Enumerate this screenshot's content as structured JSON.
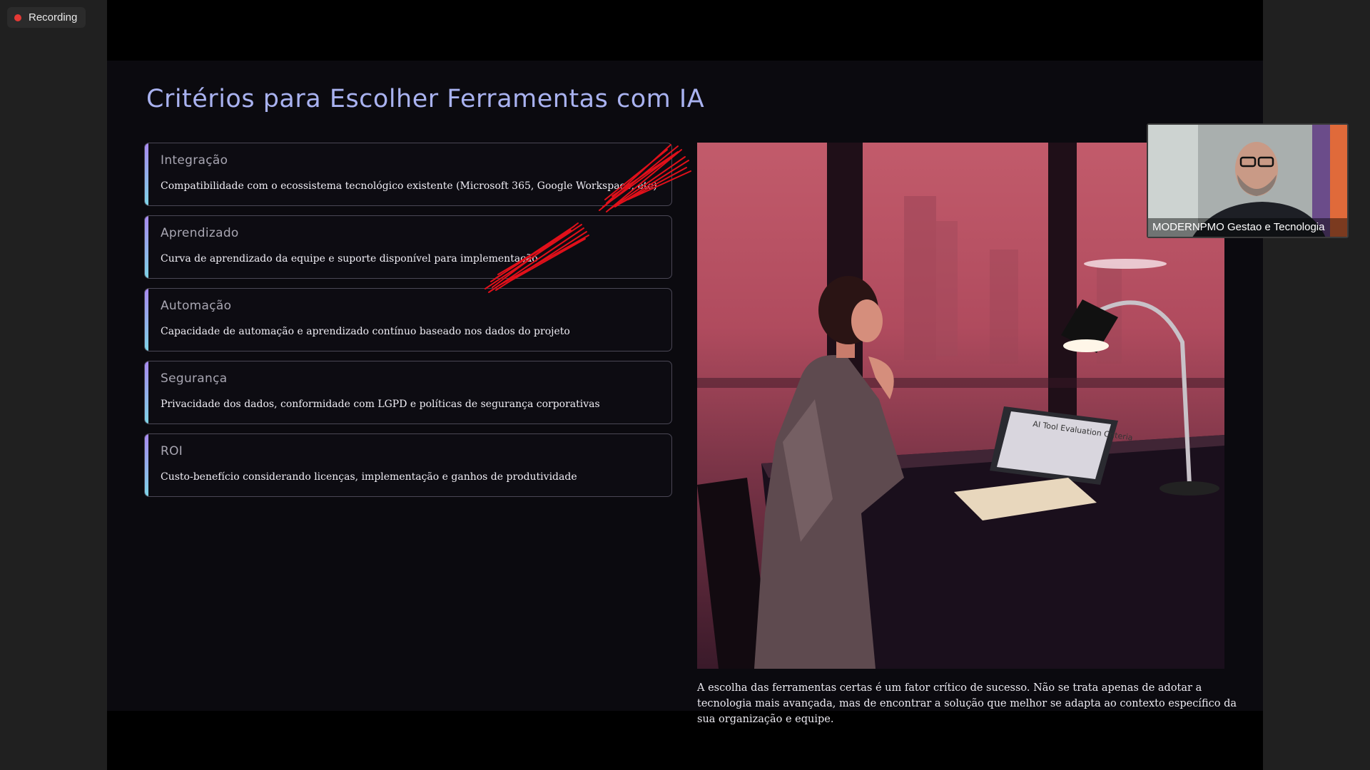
{
  "recording": {
    "label": "Recording",
    "dot_color": "#e53935"
  },
  "slide": {
    "title": "Critérios para Escolher Ferramentas com IA",
    "cards": [
      {
        "title": "Integração",
        "description": "Compatibilidade com o ecossistema tecnológico existente (Microsoft 365, Google Workspace, etc)"
      },
      {
        "title": "Aprendizado",
        "description": "Curva de aprendizado da equipe e suporte disponível para implementação"
      },
      {
        "title": "Automação",
        "description": "Capacidade de automação e aprendizado contínuo baseado nos dados do projeto"
      },
      {
        "title": "Segurança",
        "description": "Privacidade dos dados, conformidade com LGPD e políticas de segurança corporativas"
      },
      {
        "title": "ROI",
        "description": "Custo-benefício considerando licenças, implementação e ganhos de produtividade"
      }
    ],
    "image": {
      "screen_text": "AI Tool Evaluation Criteria"
    },
    "caption": "A escolha das ferramentas certas é um fator crítico de sucesso. Não se trata apenas de adotar a tecnologia mais avançada, mas de encontrar a solução que melhor se adapta ao contexto específico da sua organização e equipe."
  },
  "participant": {
    "name": "MODERNPMO Gestao e Tecnologia"
  },
  "colors": {
    "title_accent": "#a9b2f0",
    "card_accent_top": "#a98af0",
    "card_accent_bottom": "#7dd3e6",
    "annotation": "#e0101a"
  }
}
